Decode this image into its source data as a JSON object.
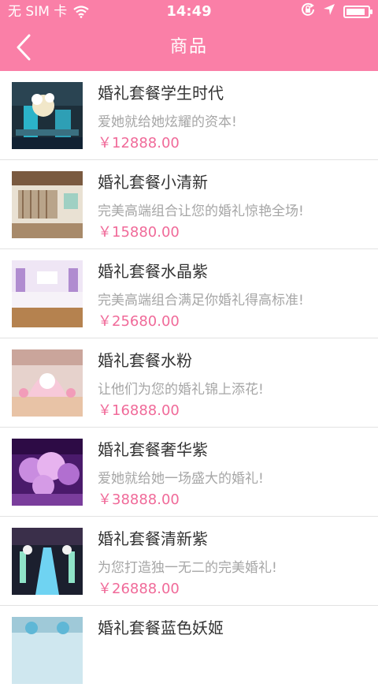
{
  "status_bar": {
    "carrier": "无 SIM 卡",
    "time": "14:49",
    "battery_level": 0.9
  },
  "nav": {
    "title": "商品",
    "back_icon": "chevron-left-icon"
  },
  "colors": {
    "header": "#fa7fa7",
    "price": "#f06a99",
    "title": "#333333",
    "desc": "#a6a6a6"
  },
  "products": [
    {
      "title": "婚礼套餐学生时代",
      "desc": "爱她就给她炫耀的资本!",
      "price": "￥12888.00"
    },
    {
      "title": "婚礼套餐小清新",
      "desc": "完美高端组合让您的婚礼惊艳全场!",
      "price": "￥15880.00"
    },
    {
      "title": "婚礼套餐水晶紫",
      "desc": "完美高端组合满足你婚礼得高标准!",
      "price": "￥25680.00"
    },
    {
      "title": "婚礼套餐水粉",
      "desc": "让他们为您的婚礼锦上添花!",
      "price": "￥16888.00"
    },
    {
      "title": "婚礼套餐奢华紫",
      "desc": "爱她就给她一场盛大的婚礼!",
      "price": "￥38888.00"
    },
    {
      "title": "婚礼套餐清新紫",
      "desc": "为您打造独一无二的完美婚礼!",
      "price": "￥26888.00"
    },
    {
      "title": "婚礼套餐蓝色妖姬",
      "desc": "",
      "price": ""
    }
  ]
}
